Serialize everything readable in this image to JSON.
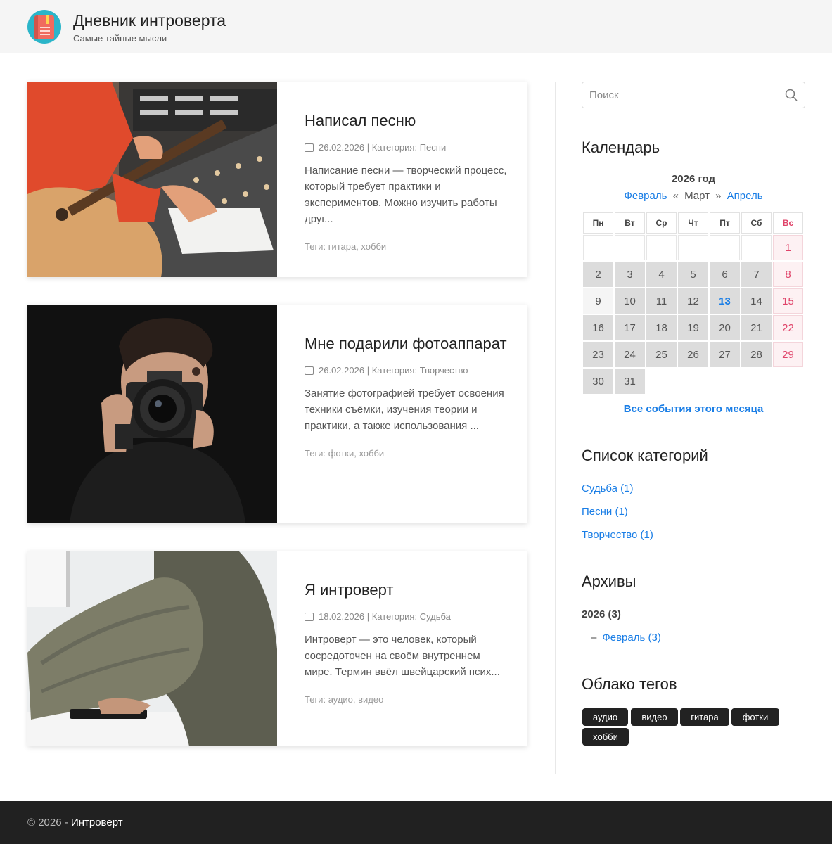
{
  "header": {
    "title": "Дневник интроверта",
    "subtitle": "Самые тайные мысли"
  },
  "posts": [
    {
      "title": "Написал песню",
      "date": "26.02.2026",
      "category_label": "Категория:",
      "category": "Песни",
      "excerpt": "Написание песни — творческий процесс, который требует практики и экспериментов. Можно изучить работы друг...",
      "tags_label": "Теги:",
      "tags": "гитара, хобби"
    },
    {
      "title": "Мне подарили фотоаппарат",
      "date": "26.02.2026",
      "category_label": "Категория:",
      "category": "Творчество",
      "excerpt": "Занятие фотографией требует освоения техники съёмки, изучения теории и практики, а также использования ...",
      "tags_label": "Теги:",
      "tags": "фотки, хобби"
    },
    {
      "title": "Я интроверт",
      "date": "18.02.2026",
      "category_label": "Категория:",
      "category": "Судьба",
      "excerpt": "Интроверт — это человек, который сосредоточен на своём внутреннем мире. Термин ввёл швейцарский псих...",
      "tags_label": "Теги:",
      "tags": "аудио, видео"
    }
  ],
  "sidebar": {
    "search_placeholder": "Поиск",
    "calendar_title": "Календарь",
    "calendar": {
      "year": "2026 год",
      "prev": "Февраль",
      "current": "Март",
      "next": "Апрель",
      "weekdays": [
        "Пн",
        "Вт",
        "Ср",
        "Чт",
        "Пт",
        "Сб",
        "Вс"
      ],
      "days": [
        [
          "",
          "",
          "",
          "",
          "",
          "",
          "1"
        ],
        [
          "2",
          "3",
          "4",
          "5",
          "6",
          "7",
          "8"
        ],
        [
          "9",
          "10",
          "11",
          "12",
          "13",
          "14",
          "15"
        ],
        [
          "16",
          "17",
          "18",
          "19",
          "20",
          "21",
          "22"
        ],
        [
          "23",
          "24",
          "25",
          "26",
          "27",
          "28",
          "29"
        ],
        [
          "30",
          "31"
        ]
      ],
      "today": "13",
      "all_events": "Все события этого месяца"
    },
    "categories_title": "Список категорий",
    "categories": [
      "Судьба (1)",
      "Песни (1)",
      "Творчество (1)"
    ],
    "archives_title": "Архивы",
    "archive_year": "2026 (3)",
    "archive_month": "Февраль (3)",
    "tags_title": "Облако тегов",
    "tags": [
      "аудио",
      "видео",
      "гитара",
      "фотки",
      "хобби"
    ]
  },
  "footer": {
    "copyright": "© 2026 -",
    "owner": "Интроверт"
  },
  "colors": {
    "accent": "#1a7ee6",
    "sunday": "#e0446a",
    "footer_bg": "#212121"
  }
}
